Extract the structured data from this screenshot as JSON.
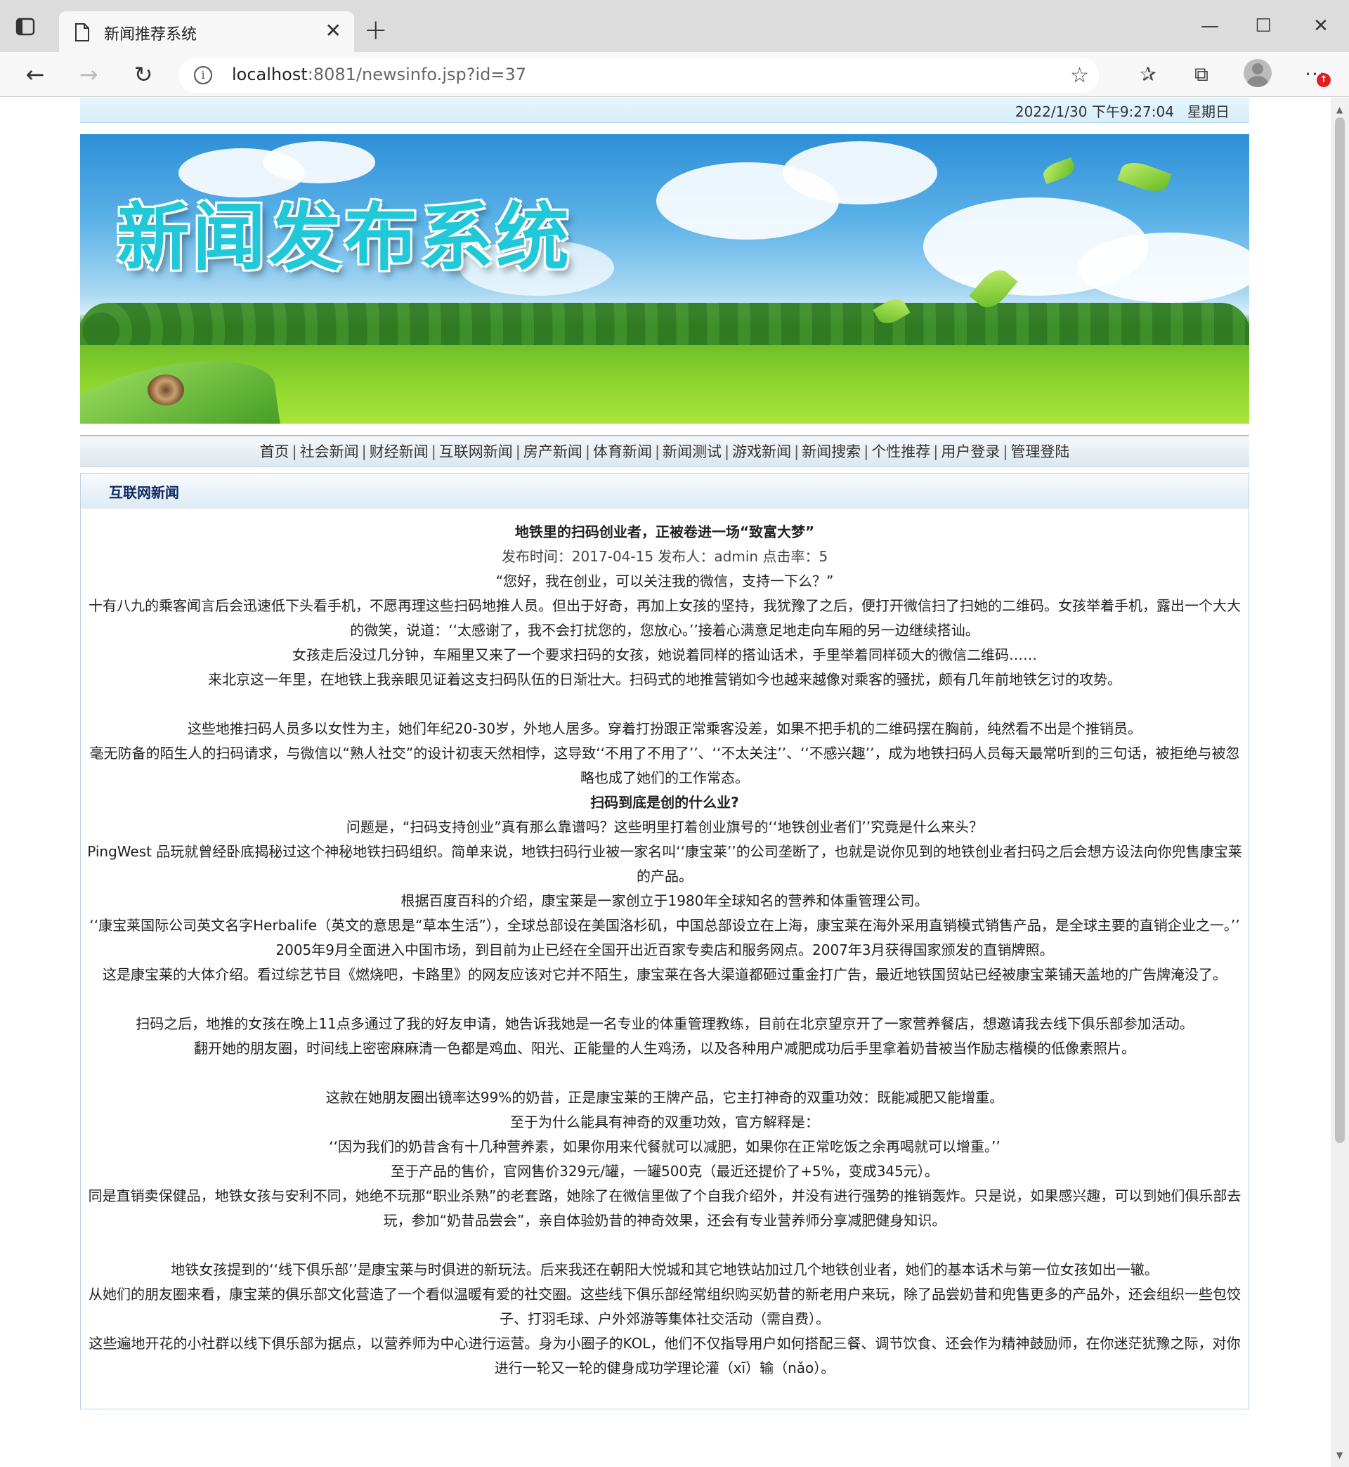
{
  "browser": {
    "tab_title": "新闻推荐系统",
    "url_host": "localhost",
    "url_rest": ":8081/newsinfo.jsp?id=37"
  },
  "page": {
    "datetime": "2022/1/30 下午9:27:04   星期日",
    "banner_title": "新闻发布系统",
    "nav": [
      "首页",
      "社会新闻",
      "财经新闻",
      "互联网新闻",
      "房产新闻",
      "体育新闻",
      "新闻测试",
      "游戏新闻",
      "新闻搜索",
      "个性推荐",
      "用户登录",
      "管理登陆"
    ],
    "section_title": "互联网新闻",
    "article": {
      "title": "地铁里的扫码创业者，正被卷进一场“致富大梦”",
      "meta": "发布时间：2017-04-15 发布人：admin 点击率：5",
      "paragraphs": [
        "“您好，我在创业，可以关注我的微信，支持一下么？”",
        "十有八九的乘客闻言后会迅速低下头看手机，不愿再理这些扫码地推人员。但出于好奇，再加上女孩的坚持，我犹豫了之后，便打开微信扫了扫她的二维码。女孩举着手机，露出一个大大的微笑，说道：‘‘太感谢了，我不会打扰您的，您放心。’’接着心满意足地走向车厢的另一边继续搭讪。",
        "女孩走后没过几分钟，车厢里又来了一个要求扫码的女孩，她说着同样的搭讪话术，手里举着同样硕大的微信二维码……",
        "来北京这一年里，在地铁上我亲眼见证着这支扫码队伍的日渐壮大。扫码式的地推营销如今也越来越像对乘客的骚扰，颇有几年前地铁乞讨的攻势。",
        "",
        "这些地推扫码人员多以女性为主，她们年纪20-30岁，外地人居多。穿着打扮跟正常乘客没差，如果不把手机的二维码摆在胸前，纯然看不出是个推销员。",
        "毫无防备的陌生人的扫码请求，与微信以“熟人社交”的设计初衷天然相悖，这导致‘‘不用了不用了’’、‘‘不太关注’’、‘‘不感兴趣’’，成为地铁扫码人员每天最常听到的三句话，被拒绝与被忽略也成了她们的工作常态。",
        "扫码到底是创的什么业?",
        "问题是，“扫码支持创业”真有那么靠谱吗？这些明里打着创业旗号的‘‘地铁创业者们’’究竟是什么来头？",
        "PingWest 品玩就曾经卧底揭秘过这个神秘地铁扫码组织。简单来说，地铁扫码行业被一家名叫‘‘康宝莱’’的公司垄断了，也就是说你见到的地铁创业者扫码之后会想方设法向你兜售康宝莱的产品。",
        "根据百度百科的介绍，康宝莱是一家创立于1980年全球知名的营养和体重管理公司。",
        "‘‘康宝莱国际公司英文名字Herbalife（英文的意思是“草本生活”），全球总部设在美国洛杉矶，中国总部设立在上海，康宝莱在海外采用直销模式销售产品，是全球主要的直销企业之一。’’",
        "2005年9月全面进入中国市场，到目前为止已经在全国开出近百家专卖店和服务网点。2007年3月获得国家颁发的直销牌照。",
        "这是康宝莱的大体介绍。看过综艺节目《燃烧吧，卡路里》的网友应该对它并不陌生，康宝莱在各大渠道都砸过重金打广告，最近地铁国贸站已经被康宝莱铺天盖地的广告牌淹没了。",
        "",
        "扫码之后，地推的女孩在晚上11点多通过了我的好友申请，她告诉我她是一名专业的体重管理教练，目前在北京望京开了一家营养餐店，想邀请我去线下俱乐部参加活动。",
        "翻开她的朋友圈，时间线上密密麻麻清一色都是鸡血、阳光、正能量的人生鸡汤，以及各种用户减肥成功后手里拿着奶昔被当作励志楷模的低像素照片。",
        "",
        "这款在她朋友圈出镜率达99%的奶昔，正是康宝莱的王牌产品，它主打神奇的双重功效：既能减肥又能增重。",
        "至于为什么能具有神奇的双重功效，官方解释是：",
        "‘‘因为我们的奶昔含有十几种营养素，如果你用来代餐就可以减肥，如果你在正常吃饭之余再喝就可以增重。’’",
        "至于产品的售价，官网售价329元/罐，一罐500克（最近还提价了+5%，变成345元）。",
        "同是直销卖保健品，地铁女孩与安利不同，她绝不玩那“职业杀熟”的老套路，她除了在微信里做了个自我介绍外，并没有进行强势的推销轰炸。只是说，如果感兴趣，可以到她们俱乐部去玩，参加“奶昔品尝会”，亲自体验奶昔的神奇效果，还会有专业营养师分享减肥健身知识。",
        "",
        "地铁女孩提到的‘‘线下俱乐部’’是康宝莱与时俱进的新玩法。后来我还在朝阳大悦城和其它地铁站加过几个地铁创业者，她们的基本话术与第一位女孩如出一辙。",
        "从她们的朋友圈来看，康宝莱的俱乐部文化营造了一个看似温暖有爱的社交圈。这些线下俱乐部经常组织购买奶昔的新老用户来玩，除了品尝奶昔和兜售更多的产品外，还会组织一些包饺子、打羽毛球、户外郊游等集体社交活动（需自费）。",
        "这些遍地开花的小社群以线下俱乐部为据点，以营养师为中心进行运营。身为小圈子的KOL，他们不仅指导用户如何搭配三餐、调节饮食、还会作为精神鼓励师，在你迷茫犹豫之际，对你进行一轮又一轮的健身成功学理论灌（xī）输（nǎo）。"
      ]
    }
  }
}
